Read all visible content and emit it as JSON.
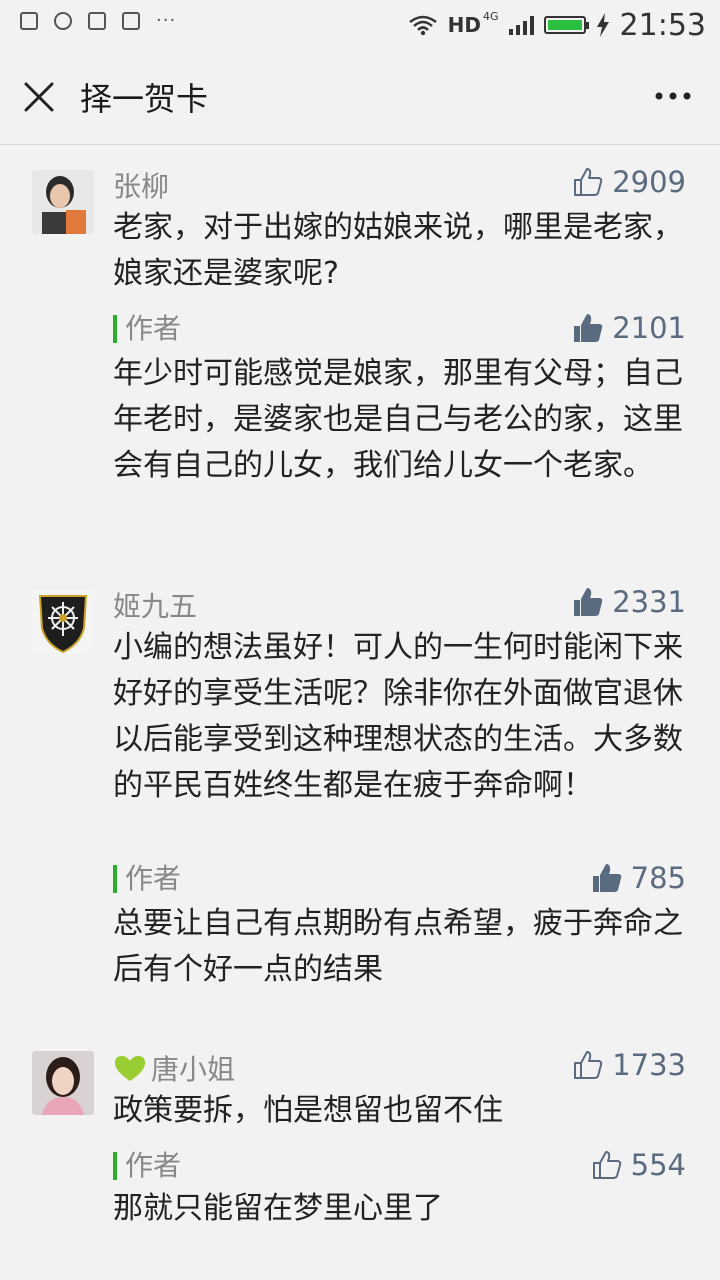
{
  "status_bar": {
    "network": "HD",
    "network_type": "4G",
    "time": "21:53"
  },
  "header": {
    "title": "择一贺卡"
  },
  "comments": [
    {
      "name": "张柳",
      "likes": "2909",
      "liked": false,
      "text": "老家，对于出嫁的姑娘来说，哪里是老家，娘家还是婆家呢?",
      "reply": {
        "label": "作者",
        "likes": "2101",
        "liked": true,
        "text": "年少时可能感觉是娘家，那里有父母；自己年老时，是婆家也是自己与老公的家，这里会有自己的儿女，我们给儿女一个老家。"
      }
    },
    {
      "name": "姬九五",
      "likes": "2331",
      "liked": true,
      "text": "小编的想法虽好！可人的一生何时能闲下来好好的享受生活呢？除非你在外面做官退休以后能享受到这种理想状态的生活。大多数的平民百姓终生都是在疲于奔命啊！",
      "reply": {
        "label": "作者",
        "likes": "785",
        "liked": true,
        "text": "总要让自己有点期盼有点希望，疲于奔命之后有个好一点的结果"
      }
    },
    {
      "name": "唐小姐",
      "likes": "1733",
      "liked": false,
      "text": "政策要拆，怕是想留也留不住",
      "reply": {
        "label": "作者",
        "likes": "554",
        "liked": false,
        "text": "那就只能留在梦里心里了"
      }
    }
  ],
  "colors": {
    "accent_green": "#2aae2c",
    "like_blue": "#5b6b7f",
    "heart_green": "#9acd32"
  }
}
